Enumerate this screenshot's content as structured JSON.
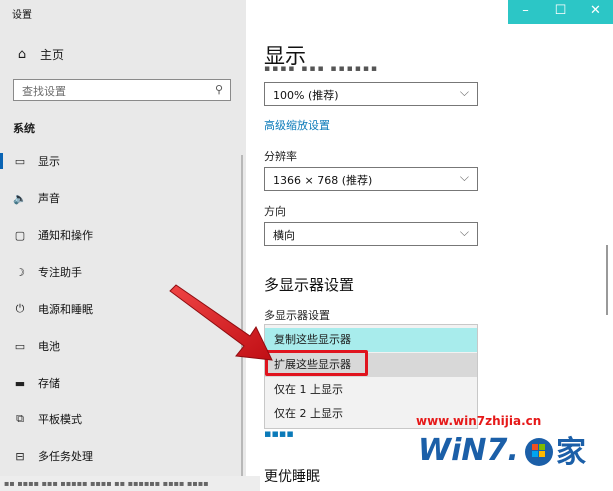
{
  "window": {
    "title": "设置",
    "controls": [
      "–",
      "☐",
      "✕"
    ]
  },
  "sidebar": {
    "home": {
      "icon": "home-icon",
      "label": "主页"
    },
    "search": {
      "placeholder": "查找设置",
      "icon": "search-icon"
    },
    "section": "系统",
    "items": [
      {
        "icon": "display-icon",
        "label": "显示",
        "active": true
      },
      {
        "icon": "sound-icon",
        "label": "声音"
      },
      {
        "icon": "notifications-icon",
        "label": "通知和操作"
      },
      {
        "icon": "focus-assist-icon",
        "label": "专注助手"
      },
      {
        "icon": "power-icon",
        "label": "电源和睡眠"
      },
      {
        "icon": "battery-icon",
        "label": "电池"
      },
      {
        "icon": "storage-icon",
        "label": "存储"
      },
      {
        "icon": "tablet-mode-icon",
        "label": "平板模式"
      },
      {
        "icon": "multitasking-icon",
        "label": "多任务处理"
      }
    ]
  },
  "main": {
    "title": "显示",
    "scale": {
      "value": "100% (推荐)"
    },
    "advanced_scaling_link": "高级缩放设置",
    "resolution": {
      "label": "分辨率",
      "value": "1366 × 768 (推荐)"
    },
    "orientation": {
      "label": "方向",
      "value": "横向"
    },
    "multi_display": {
      "heading": "多显示器设置",
      "label": "多显示器设置",
      "options": [
        "复制这些显示器",
        "扩展这些显示器",
        "仅在 1 上显示",
        "仅在 2 上显示"
      ],
      "selected_index": 0,
      "highlighted_index": 1
    },
    "sleep_heading": "更优睡眠"
  },
  "watermark": {
    "url": "www.win7zhijia.cn",
    "brand": "WiN7.",
    "brand_suffix": "家"
  },
  "colors": {
    "accent": "#0a64b4",
    "titlebar": "#2cc6c6",
    "selected_option": "#a8ecec",
    "annotation_red": "#e0141e"
  }
}
